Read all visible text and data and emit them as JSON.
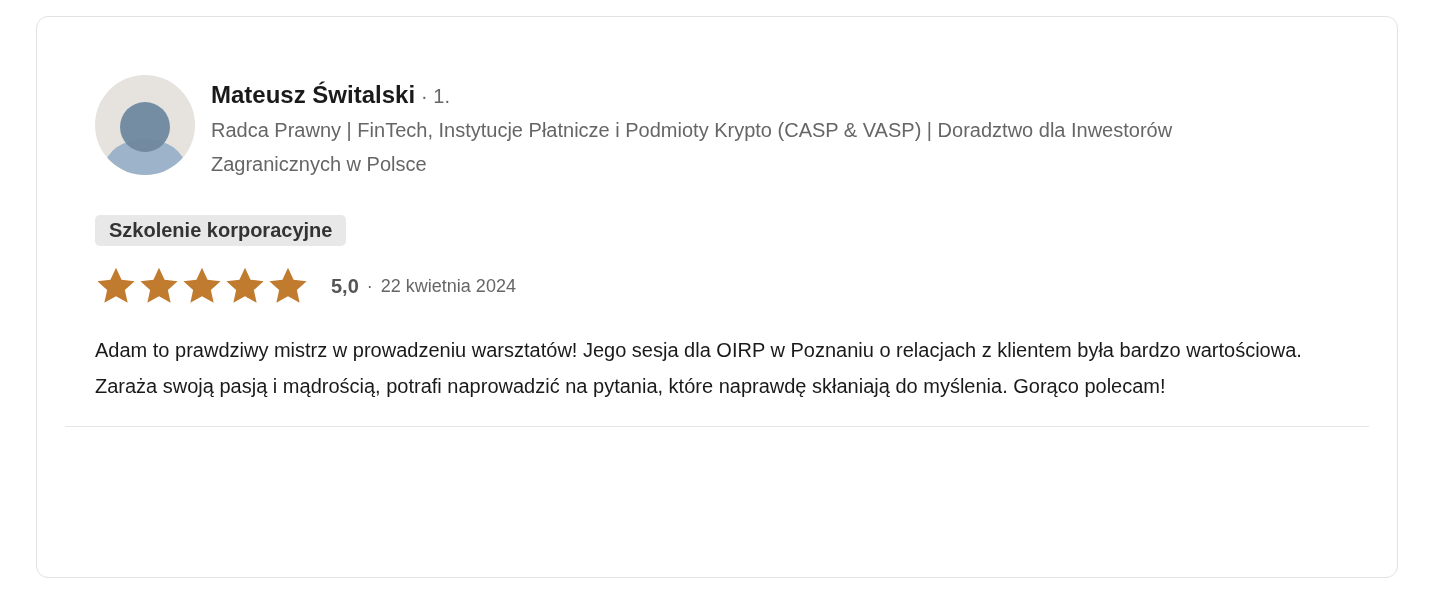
{
  "review": {
    "author": {
      "name": "Mateusz Świtalski",
      "connection": "· 1.",
      "headline": "Radca Prawny | FinTech, Instytucje Płatnicze i Podmioty Krypto (CASP & VASP) | Doradztwo dla Inwestorów Zagranicznych w Polsce"
    },
    "tag": "Szkolenie korporacyjne",
    "stars": 5,
    "rating": "5,0",
    "separator": "·",
    "date": "22 kwietnia 2024",
    "text": "Adam to prawdziwy mistrz w prowadzeniu warsztatów! Jego sesja dla OIRP w Poznaniu o relacjach z klientem była bardzo wartościowa. Zaraża swoją pasją i mądrością, potrafi naprowadzić na pytania, które naprawdę skłaniają do myślenia. Gorąco polecam!"
  }
}
